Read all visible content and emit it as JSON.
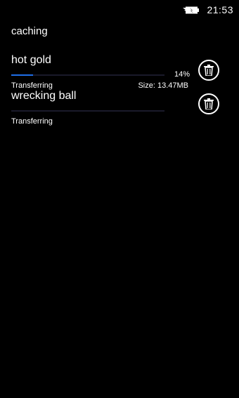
{
  "status_bar": {
    "battery_icon": "battery-charging-icon",
    "time": "21:53"
  },
  "page": {
    "title": "caching"
  },
  "downloads": [
    {
      "name": "hot gold",
      "progress_fraction": 0.14,
      "percent_label": "14%",
      "status": "Transferring",
      "size_label": "Size: 13.47MB",
      "delete_icon": "trash-icon"
    },
    {
      "name": "wrecking ball",
      "progress_fraction": 0.0,
      "percent_label": "",
      "status": "Transferring",
      "size_label": "",
      "delete_icon": "trash-icon"
    }
  ],
  "colors": {
    "background": "#000000",
    "text": "#ffffff",
    "accent": "#1f6ee8"
  }
}
